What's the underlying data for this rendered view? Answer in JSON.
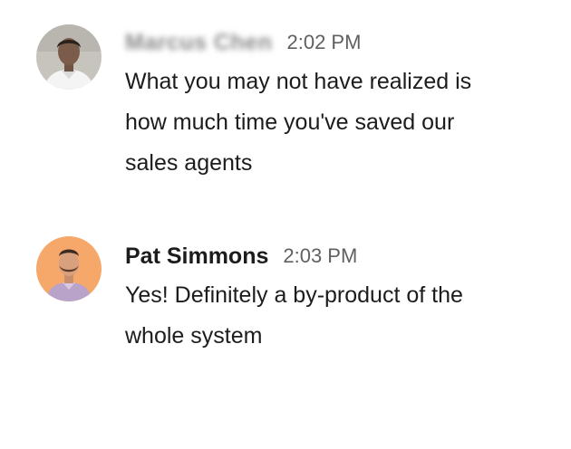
{
  "messages": [
    {
      "sender": "Marcus Chen",
      "sender_obscured": true,
      "time": "2:02 PM",
      "text": "What you may not have realized is\nhow much time you've saved our\nsales agents",
      "avatar_icon": "user-avatar-photo",
      "avatar_bg": "#c7c4be"
    },
    {
      "sender": "Pat Simmons",
      "sender_obscured": false,
      "time": "2:03 PM",
      "text": "Yes! Definitely a by-product of the\nwhole system",
      "avatar_icon": "user-avatar-photo",
      "avatar_bg": "#f6a86b"
    }
  ],
  "colors": {
    "text": "#1d1c1d",
    "timestamp": "#616061",
    "background": "#ffffff"
  }
}
